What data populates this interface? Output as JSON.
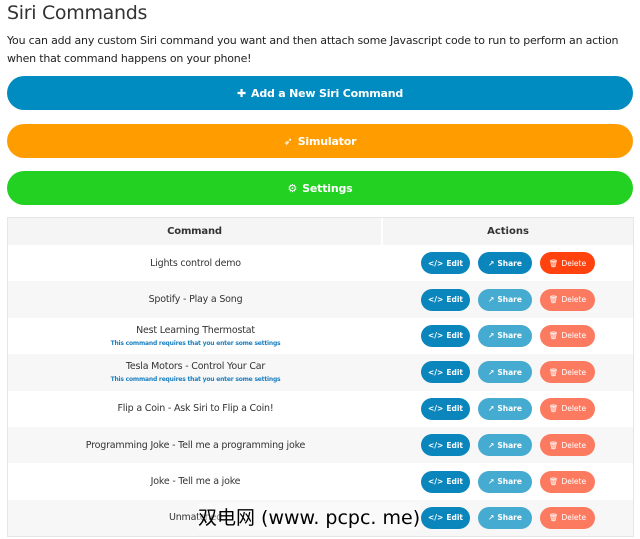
{
  "title": "Siri Commands",
  "description": "You can add any custom Siri command you want and then attach some Javascript code to run to perform an action when that command happens on your phone!",
  "buttons": {
    "add": "Add a New Siri Command",
    "simulator": "Simulator",
    "settings": "Settings"
  },
  "table": {
    "headers": [
      "Command",
      "Actions"
    ],
    "actions": {
      "edit": "Edit",
      "share": "Share",
      "delete": "Delete"
    },
    "rows": [
      {
        "name": "Lights control demo",
        "note": ""
      },
      {
        "name": "Spotify - Play a Song",
        "note": ""
      },
      {
        "name": "Nest Learning Thermostat",
        "note": "This command requires that you enter some settings"
      },
      {
        "name": "Tesla Motors - Control Your Car",
        "note": "This command requires that you enter some settings"
      },
      {
        "name": "Flip a Coin - Ask Siri to Flip a Coin!",
        "note": ""
      },
      {
        "name": "Programming Joke - Tell me a programming joke",
        "note": ""
      },
      {
        "name": "Joke - Tell me a joke",
        "note": ""
      },
      {
        "name": "Unmatched",
        "note": ""
      }
    ]
  },
  "watermark": "双电网 (www. pcpc. me)"
}
